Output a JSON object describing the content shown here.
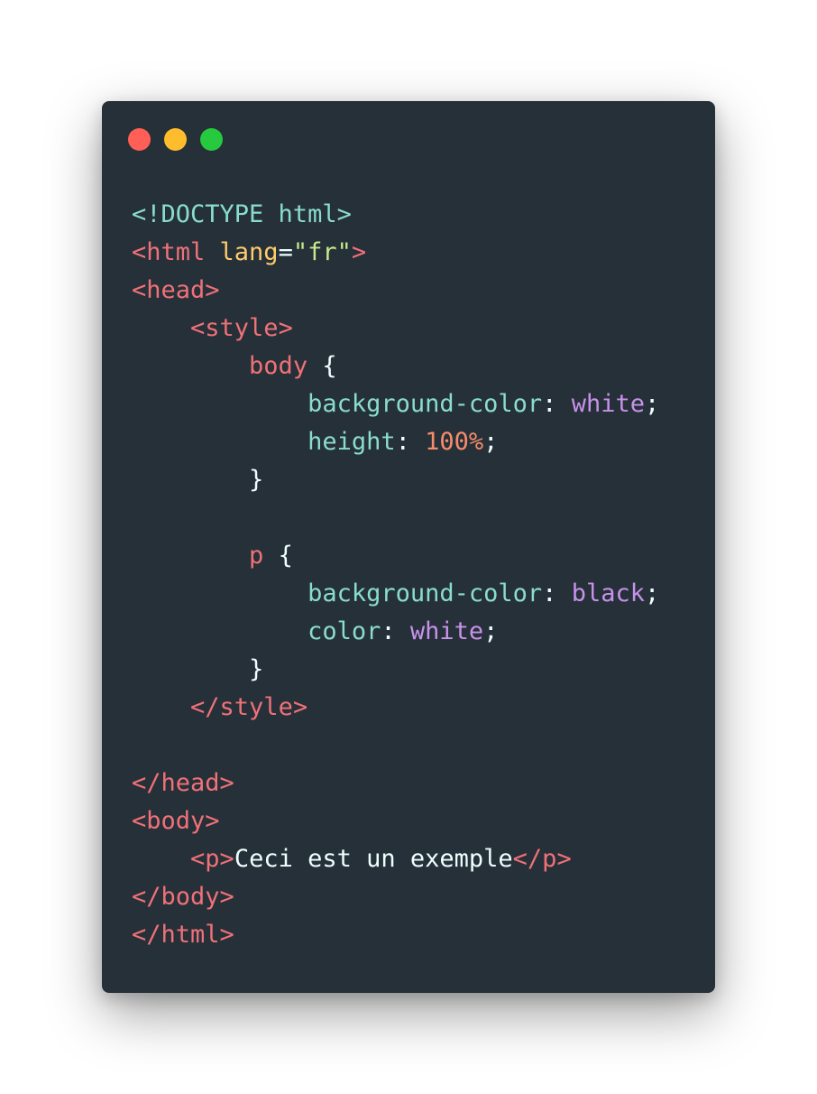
{
  "window": {
    "controls": [
      "close",
      "minimize",
      "maximize"
    ],
    "colors": {
      "background": "#263038",
      "close": "#ff5f56",
      "minimize": "#ffbd2e",
      "maximize": "#27c93f"
    }
  },
  "syntax_colors": {
    "doctype": "#89ddcc",
    "tag": "#f07178",
    "attribute": "#ffcb6b",
    "string": "#c3e88d",
    "property": "#89ddcc",
    "value": "#c792ea",
    "number": "#f78c6c",
    "text": "#eeffff"
  },
  "code": {
    "line1": {
      "doctype": "<!DOCTYPE html>"
    },
    "line2": {
      "tag_open": "<html",
      "attr": " lang",
      "eq": "=",
      "str": "\"fr\"",
      "tag_close": ">"
    },
    "line3": {
      "tag": "<head>"
    },
    "line4": {
      "indent": "    ",
      "tag": "<style>"
    },
    "line5": {
      "indent": "        ",
      "selector": "body",
      "brace": " {"
    },
    "line6": {
      "indent": "            ",
      "prop": "background-color",
      "colon": ": ",
      "val": "white",
      "semi": ";"
    },
    "line7": {
      "indent": "            ",
      "prop": "height",
      "colon": ": ",
      "val": "100%",
      "semi": ";"
    },
    "line8": {
      "indent": "        ",
      "brace": "}"
    },
    "line9": {
      "text": ""
    },
    "line10": {
      "indent": "        ",
      "selector": "p",
      "brace": " {"
    },
    "line11": {
      "indent": "            ",
      "prop": "background-color",
      "colon": ": ",
      "val": "black",
      "semi": ";"
    },
    "line12": {
      "indent": "            ",
      "prop": "color",
      "colon": ": ",
      "val": "white",
      "semi": ";"
    },
    "line13": {
      "indent": "        ",
      "brace": "}"
    },
    "line14": {
      "indent": "    ",
      "tag": "</style>"
    },
    "line15": {
      "text": ""
    },
    "line16": {
      "tag": "</head>"
    },
    "line17": {
      "tag": "<body>"
    },
    "line18": {
      "indent": "    ",
      "tag_open": "<p>",
      "text": "Ceci est un exemple",
      "tag_close": "</p>"
    },
    "line19": {
      "tag": "</body>"
    },
    "line20": {
      "tag": "</html>"
    }
  }
}
